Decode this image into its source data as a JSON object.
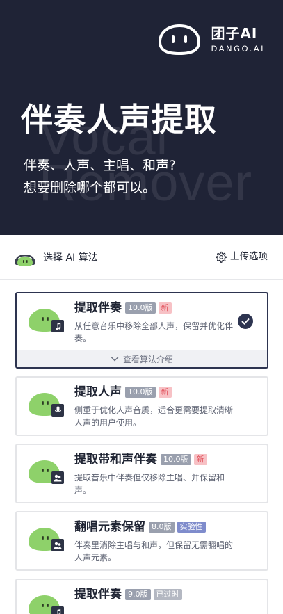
{
  "brand": {
    "name": "团子AI",
    "sub": "DANGO.AI"
  },
  "hero": {
    "title": "伴奏人声提取",
    "subtitle_line1": "伴奏、人声、主唱、和声?",
    "subtitle_line2": "想要删除哪个都可以。",
    "watermark_line1": "Vocal",
    "watermark_line2": "Remover"
  },
  "panel": {
    "select_label": "选择 AI 算法",
    "upload_options_label": "上传选项"
  },
  "algorithms": [
    {
      "name": "提取伴奏",
      "version": "10.0版",
      "badge": "新",
      "desc": "从任意音乐中移除全部人声，保留并优化伴奏。",
      "selected": true,
      "icon": "music-note-icon",
      "intro": "查看算法介绍"
    },
    {
      "name": "提取人声",
      "version": "10.0版",
      "badge": "新",
      "desc": "侧重于优化人声音质，适合更需要提取清晰人声的用户使用。",
      "selected": false,
      "icon": "microphone-icon"
    },
    {
      "name": "提取带和声伴奏",
      "version": "10.0版",
      "badge": "新",
      "desc": "提取音乐中伴奏但仅移除主唱、并保留和声。",
      "selected": false,
      "icon": "people-icon"
    },
    {
      "name": "翻唱元素保留",
      "version": "8.0版",
      "badge": "实验性",
      "desc": "伴奏里消除主唱与和声，但保留无需翻唱的人声元素。",
      "selected": false,
      "icon": "people-icon"
    },
    {
      "name": "提取伴奏",
      "version": "9.0版",
      "badge": "已过时",
      "desc": "",
      "selected": false,
      "icon": "music-note-icon"
    }
  ],
  "colors": {
    "hero_bg": "#1f2336",
    "accent": "#2d3450",
    "dango_green": "#8ed16a",
    "badge_new": "#e2535d"
  }
}
